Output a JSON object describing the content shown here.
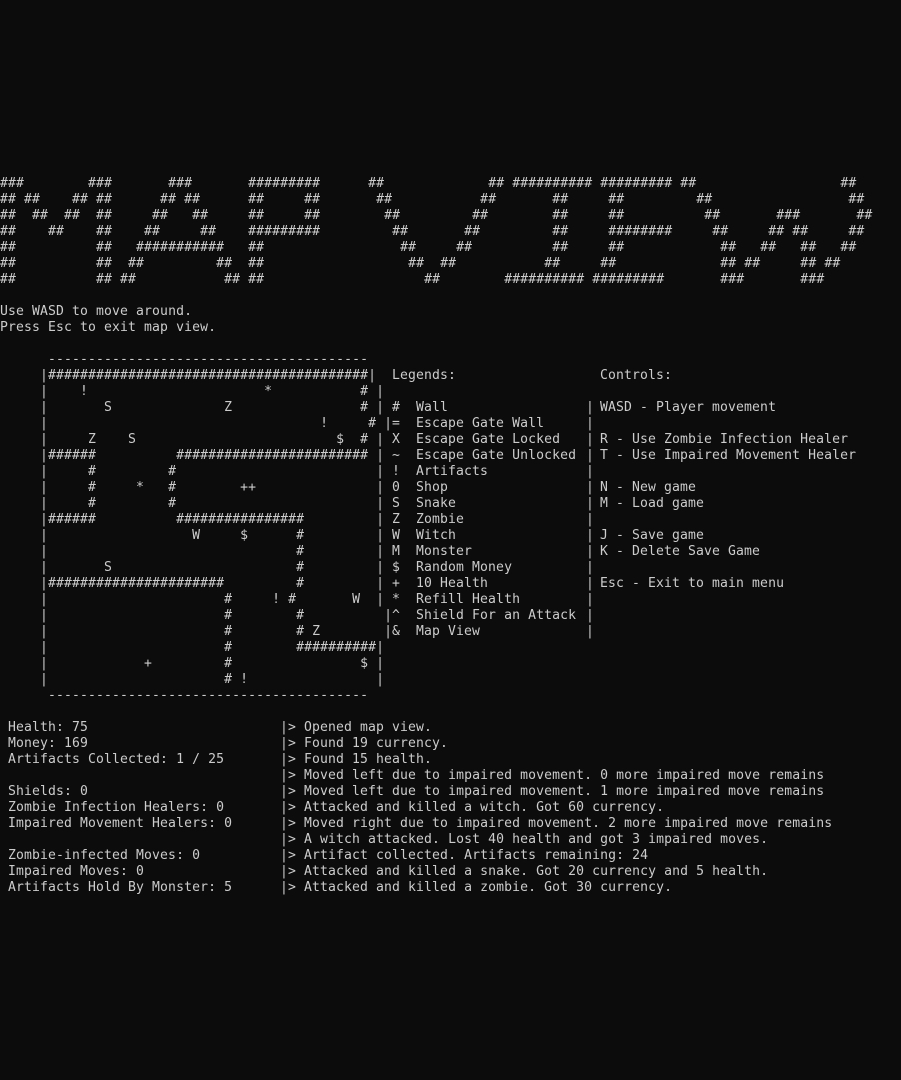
{
  "colors": {
    "background": "#0c0c0c",
    "text": "#cccccc"
  },
  "banner": "###        ###       ###       #########      ##             ## ########## ######### ##                  ##\n## ##    ## ##      ## ##      ##     ##       ##           ##       ##     ##         ##                 ##\n##  ##  ##  ##     ##   ##     ##     ##        ##         ##        ##     ##          ##       ###       ##\n##    ##    ##    ##     ##    #########         ##       ##         ##     ########     ##     ## ##     ##\n##          ##   ###########   ##                 ##     ##          ##     ##            ##   ##   ##   ##\n##          ##  ##         ##  ##                  ##  ##           ##     ##             ## ##     ## ##\n##          ## ##           ## ##                    ##        ########## #########       ###       ###",
  "instructions": [
    "Use WASD to move around.",
    "Press Esc to exit map view."
  ],
  "map": {
    "rows": [
      "      ----------------------------------------",
      "     |########################################|",
      "     |    !                      *           # |",
      "     |       S              Z                # |",
      "     |                                  !     # |",
      "     |     Z    S                         $  # |",
      "     |######          ######################## |",
      "     |     #         #                         |",
      "     |     #     *   #        ++               |",
      "     |     #         #                         |",
      "     |######          ################         |",
      "     |                  W     $      #         |",
      "     |                               #         |",
      "     |       S                       #         |",
      "     |######################         #         |",
      "     |                      #     ! #       W  |",
      "     |                      #        #          |",
      "     |                      #        # Z        |",
      "     |                      #        ##########|",
      "     |            +         #                $ |",
      "     |                      # !                |",
      "      ----------------------------------------"
    ]
  },
  "legend": {
    "title": "Legends:",
    "items": [
      {
        "symbol": "#",
        "label": "Wall"
      },
      {
        "symbol": "=",
        "label": "Escape Gate Wall"
      },
      {
        "symbol": "X",
        "label": "Escape Gate Locked"
      },
      {
        "symbol": "~",
        "label": "Escape Gate Unlocked"
      },
      {
        "symbol": "!",
        "label": "Artifacts"
      },
      {
        "symbol": "0",
        "label": "Shop"
      },
      {
        "symbol": "S",
        "label": "Snake"
      },
      {
        "symbol": "Z",
        "label": "Zombie"
      },
      {
        "symbol": "W",
        "label": "Witch"
      },
      {
        "symbol": "M",
        "label": "Monster"
      },
      {
        "symbol": "$",
        "label": "Random Money"
      },
      {
        "symbol": "+",
        "label": "10 Health"
      },
      {
        "symbol": "*",
        "label": "Refill Health"
      },
      {
        "symbol": "^",
        "label": "Shield For an Attack"
      },
      {
        "symbol": "&",
        "label": "Map View"
      }
    ]
  },
  "controls": {
    "title": "Controls:",
    "lines": [
      "",
      "WASD - Player movement",
      "",
      "R - Use Zombie Infection Healer",
      "T - Use Impaired Movement Healer",
      "",
      "N - New game",
      "M - Load game",
      "",
      "J - Save game",
      "K - Delete Save Game",
      "",
      "Esc - Exit to main menu"
    ]
  },
  "stats": {
    "lines": [
      "Health: 75",
      "Money: 169",
      "Artifacts Collected: 1 / 25",
      "",
      "Shields: 0",
      "Zombie Infection Healers: 0",
      "Impaired Movement Healers: 0",
      "",
      "Zombie-infected Moves: 0",
      "Impaired Moves: 0",
      "Artifacts Hold By Monster: 5"
    ]
  },
  "log": {
    "lines": [
      "|> Opened map view.",
      "|> Found 19 currency.",
      "|> Found 15 health.",
      "|> Moved left due to impaired movement. 0 more impaired move remains",
      "|> Moved left due to impaired movement. 1 more impaired move remains",
      "|> Attacked and killed a witch. Got 60 currency.",
      "|> Moved right due to impaired movement. 2 more impaired move remains",
      "|> A witch attacked. Lost 40 health and got 3 impaired moves.",
      "|> Artifact collected. Artifacts remaining: 24",
      "|> Attacked and killed a snake. Got 20 currency and 5 health.",
      "|> Attacked and killed a zombie. Got 30 currency."
    ]
  }
}
